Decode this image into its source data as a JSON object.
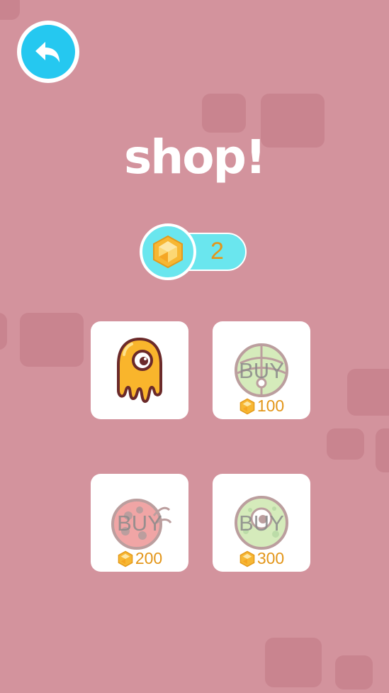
{
  "header": {
    "back_icon": "back-arrow-icon",
    "title": "shop!"
  },
  "currency": {
    "icon": "gem-icon",
    "count": "2",
    "colors": {
      "pill": "#6ae6ee",
      "count": "#e3961a"
    }
  },
  "shop": {
    "items": [
      {
        "character": "yellow-blob",
        "state": "owned",
        "buy_label": "",
        "price": ""
      },
      {
        "character": "green-ball",
        "state": "locked",
        "buy_label": "BUY",
        "price": "100"
      },
      {
        "character": "ladybug",
        "state": "locked",
        "buy_label": "BUY",
        "price": "200"
      },
      {
        "character": "green-ball-dots",
        "state": "locked",
        "buy_label": "BUY",
        "price": "300"
      }
    ]
  },
  "theme": {
    "background": "#d3939d",
    "back_button": "#25c8f0"
  }
}
